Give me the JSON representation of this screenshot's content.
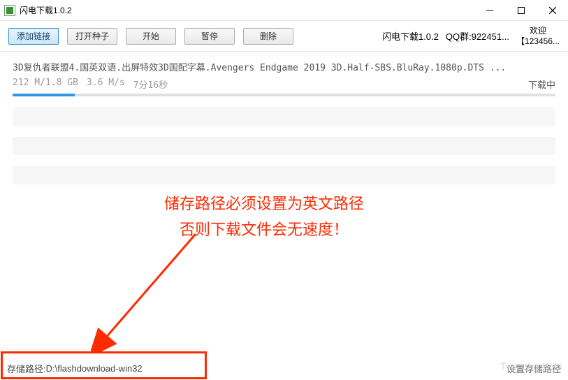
{
  "window": {
    "title": "闪电下载1.0.2"
  },
  "toolbar": {
    "add_link": "添加链接",
    "open_torrent": "打开种子",
    "start": "开始",
    "pause": "暂停",
    "delete": "删除",
    "version": "闪电下载1.0.2",
    "qq_group": "QQ群:922451...",
    "welcome": "欢迎",
    "welcome_id": "【123456..."
  },
  "download": {
    "name": "3D复仇者联盟4.国英双语.出屏特效3D国配字幕.Avengers Endgame 2019 3D.Half-SBS.BluRay.1080p.DTS ...",
    "size": "212 M/1.8 GB",
    "speed": "3.6 M/s",
    "eta": "7分16秒",
    "status": "下载中"
  },
  "annotation": {
    "line1": "储存路径必须设置为英文路径",
    "line2": "否则下载文件会无速度！"
  },
  "statusbar": {
    "path_label": "存储路径:",
    "path_value": "D:\\flashdownload-win32",
    "set_path": "设置存储路径"
  },
  "watermark": "Typecho.Wiki"
}
